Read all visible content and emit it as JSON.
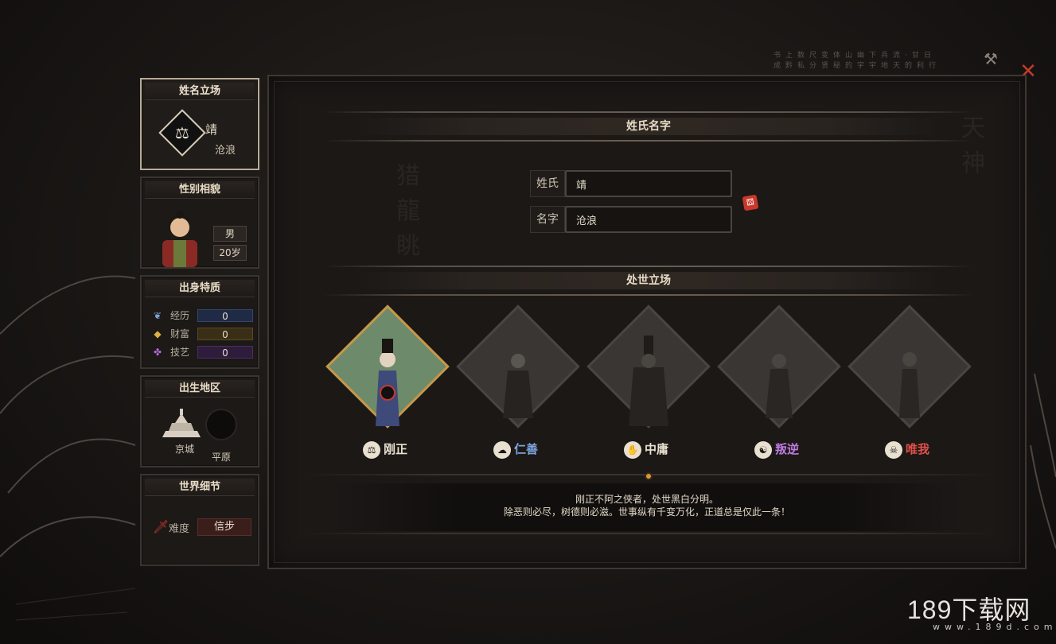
{
  "sidebar": {
    "name_card": {
      "title": "姓名立场",
      "given": "靖",
      "sub": "沧浪"
    },
    "gender_card": {
      "title": "性别相貌",
      "gender": "男",
      "age": "20岁"
    },
    "origin_card": {
      "title": "出身特质",
      "stats": [
        {
          "label": "经历",
          "value": "0",
          "icon": "feather-icon",
          "color": "#4b6bb8"
        },
        {
          "label": "财富",
          "value": "0",
          "icon": "gold-icon",
          "color": "#8a6b22"
        },
        {
          "label": "技艺",
          "value": "0",
          "icon": "petal-icon",
          "color": "#6b3a8a"
        }
      ]
    },
    "birth_card": {
      "title": "出生地区",
      "city": "京城",
      "plain": "平原"
    },
    "world_card": {
      "title": "世界细节",
      "difficulty_label": "难度",
      "difficulty_value": "信步"
    }
  },
  "main": {
    "section_name": "姓氏名字",
    "surname_label": "姓氏",
    "surname_value": "靖",
    "given_label": "名字",
    "given_value": "沧浪",
    "section_stance": "处世立场",
    "stances": [
      {
        "label": "刚正",
        "color": "#e9e0d0",
        "selected": true
      },
      {
        "label": "仁善",
        "color": "#7ea6e0",
        "selected": false
      },
      {
        "label": "中庸",
        "color": "#e9e0d0",
        "selected": false
      },
      {
        "label": "叛逆",
        "color": "#c07ce0",
        "selected": false
      },
      {
        "label": "唯我",
        "color": "#e0504a",
        "selected": false
      }
    ],
    "description_line1": "刚正不阿之侠者，处世黑白分明。",
    "description_line2": "除恶则必尽，树德则必滋。世事纵有千变万化，正道总是仅此一条！"
  },
  "watermark": {
    "main": "189下载网",
    "sub": "www.189d.com"
  }
}
